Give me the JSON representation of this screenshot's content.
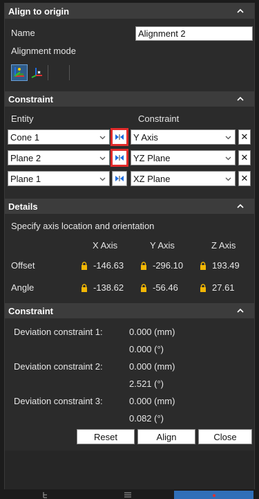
{
  "header": {
    "title": "Align to origin"
  },
  "general": {
    "name_label": "Name",
    "name_value": "Alignment 2",
    "mode_label": "Alignment mode",
    "tools": [
      "axis-align-icon",
      "point-align-icon"
    ]
  },
  "constraint": {
    "title": "Constraint",
    "col_entity": "Entity",
    "col_constraint": "Constraint",
    "rows": [
      {
        "entity": "Cone 1",
        "constraint": "Y Axis",
        "highlight": true
      },
      {
        "entity": "Plane 2",
        "constraint": "YZ Plane",
        "highlight": true
      },
      {
        "entity": "Plane 1",
        "constraint": "XZ Plane",
        "highlight": false
      }
    ],
    "remove_symbol": "✕"
  },
  "details": {
    "title": "Details",
    "description": "Specify axis location and orientation",
    "headers": [
      "X Axis",
      "Y Axis",
      "Z Axis"
    ],
    "offset_label": "Offset",
    "offset": [
      "-146.63",
      "-296.10",
      "193.49"
    ],
    "angle_label": "Angle",
    "angle": [
      "-138.62",
      "-56.46",
      "27.61"
    ]
  },
  "deviation": {
    "title": "Constraint",
    "items": [
      {
        "label": "Deviation constraint 1:",
        "mm": "0.000 (mm)",
        "deg": "0.000 (°)"
      },
      {
        "label": "Deviation constraint 2:",
        "mm": "0.000 (mm)",
        "deg": "2.521 (°)"
      },
      {
        "label": "Deviation constraint 3:",
        "mm": "0.000 (mm)",
        "deg": "0.082 (°)"
      }
    ]
  },
  "buttons": {
    "reset": "Reset",
    "align": "Align",
    "close": "Close"
  },
  "colors": {
    "header_bg": "#3c3c3c",
    "panel_bg": "#2b2b2b",
    "highlight": "#e02a2a",
    "lock": "#f2b705",
    "active_tab": "#2f6fb8"
  }
}
